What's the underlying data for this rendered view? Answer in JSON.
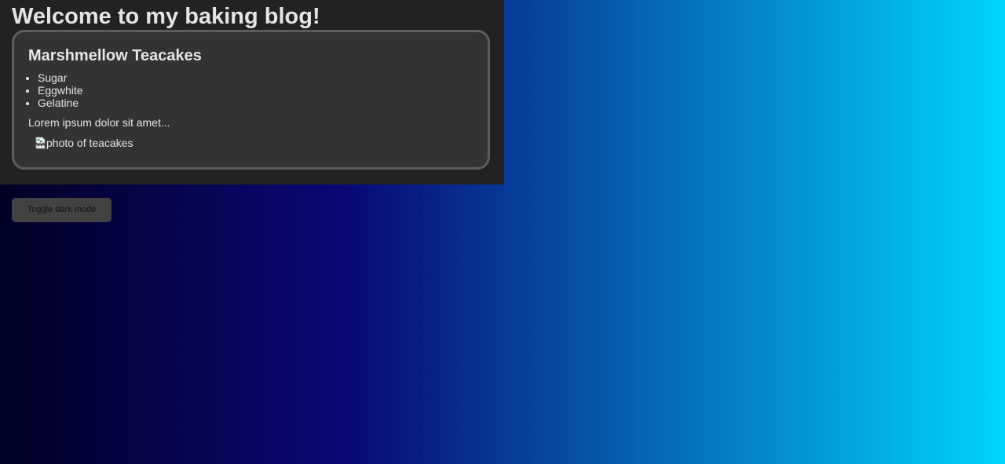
{
  "header": {
    "title": "Welcome to my baking blog!"
  },
  "recipe": {
    "title": "Marshmellow Teacakes",
    "ingredients": [
      "Sugar",
      "Eggwhite",
      "Gelatine"
    ],
    "description": "Lorem ipsum dolor sit amet...",
    "image_alt": "photo of teacakes",
    "image_icon": "broken-image-icon"
  },
  "controls": {
    "toggle_label": "Toggle dark mode"
  },
  "colors": {
    "background_gradient": [
      "#020024",
      "#090979",
      "#00d4ff"
    ],
    "panel_bg": "#222222",
    "card_bg": "#333333",
    "card_border": "#5d5d5d",
    "text": "#e4e4e4",
    "button_bg": "#424242"
  }
}
